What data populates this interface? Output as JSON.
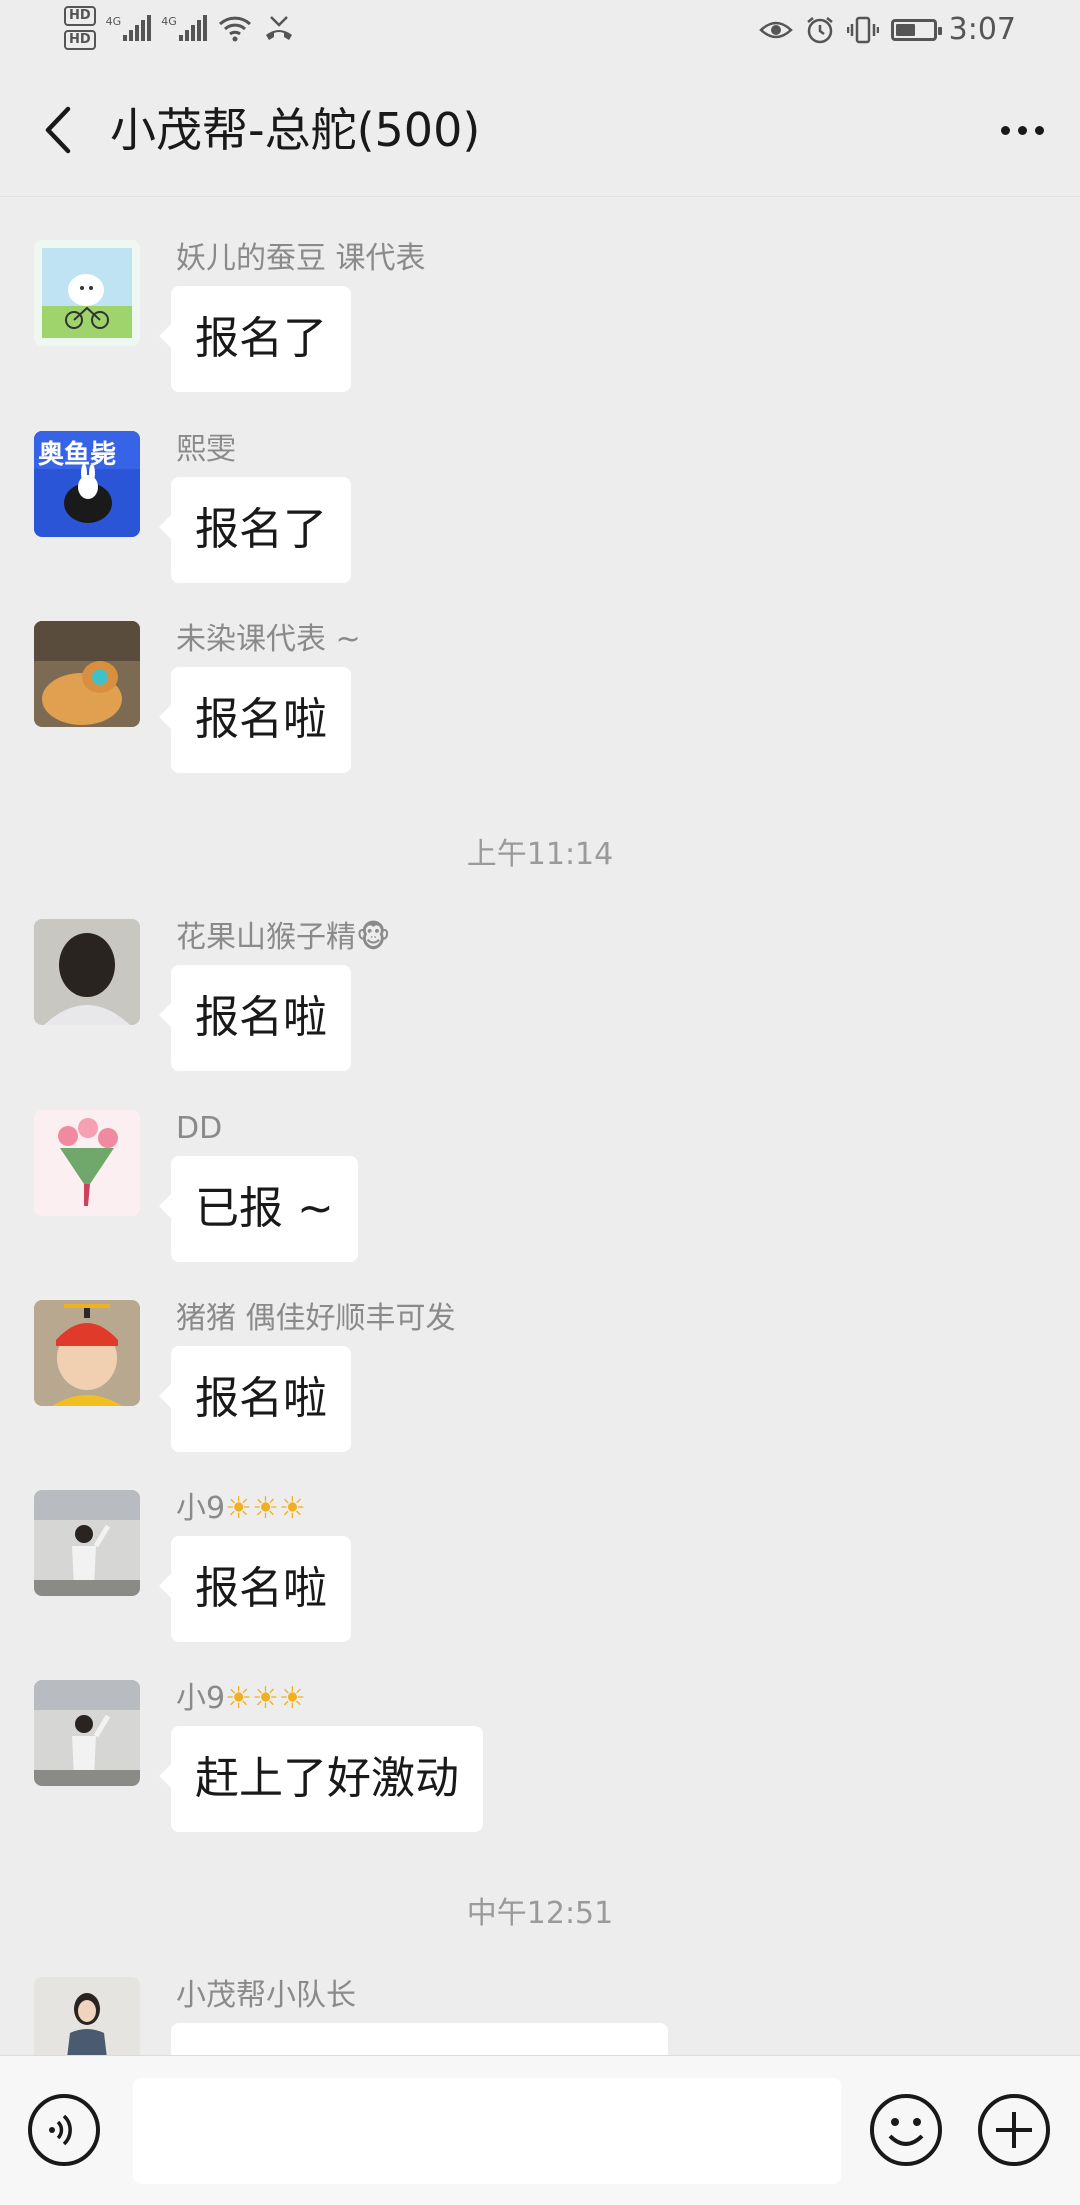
{
  "status_bar": {
    "hd1": "HD",
    "hd2": "HD",
    "net1": "4G",
    "net2": "4G",
    "time": "3:07",
    "battery_level_percent": 55
  },
  "header": {
    "title": "小茂帮-总舵(500)"
  },
  "messages": [
    {
      "sender": "妖儿的蚕豆 课代表",
      "text": "报名了"
    },
    {
      "sender": "熙雯",
      "text": "报名了"
    },
    {
      "sender": "未染课代表 ~",
      "text": "报名啦"
    },
    {
      "sender": "花果山猴子精",
      "sender_emoji": "🐵",
      "text": "报名啦"
    },
    {
      "sender": "DD",
      "text": "已报 ~"
    },
    {
      "sender": "猪猪   偶佳好顺丰可发",
      "text": "报名啦"
    },
    {
      "sender": "小9",
      "sender_emoji": "☀☀☀",
      "text": "报名啦"
    },
    {
      "sender": "小9",
      "sender_emoji": "☀☀☀",
      "text": "赶上了好激动"
    },
    {
      "sender": "小茂帮小队长",
      "text": ""
    }
  ],
  "timestamps": [
    "上午11:14",
    "中午12:51"
  ],
  "icons": {
    "back": "chevron-left-icon",
    "more": "more-dots-icon",
    "voice": "voice-icon",
    "emoji": "smiley-icon",
    "plus": "plus-icon"
  },
  "colors": {
    "background": "#ededed",
    "bubble": "#ffffff",
    "sender_text": "#8a8a8a",
    "timestamp_text": "#9a9a9a"
  }
}
